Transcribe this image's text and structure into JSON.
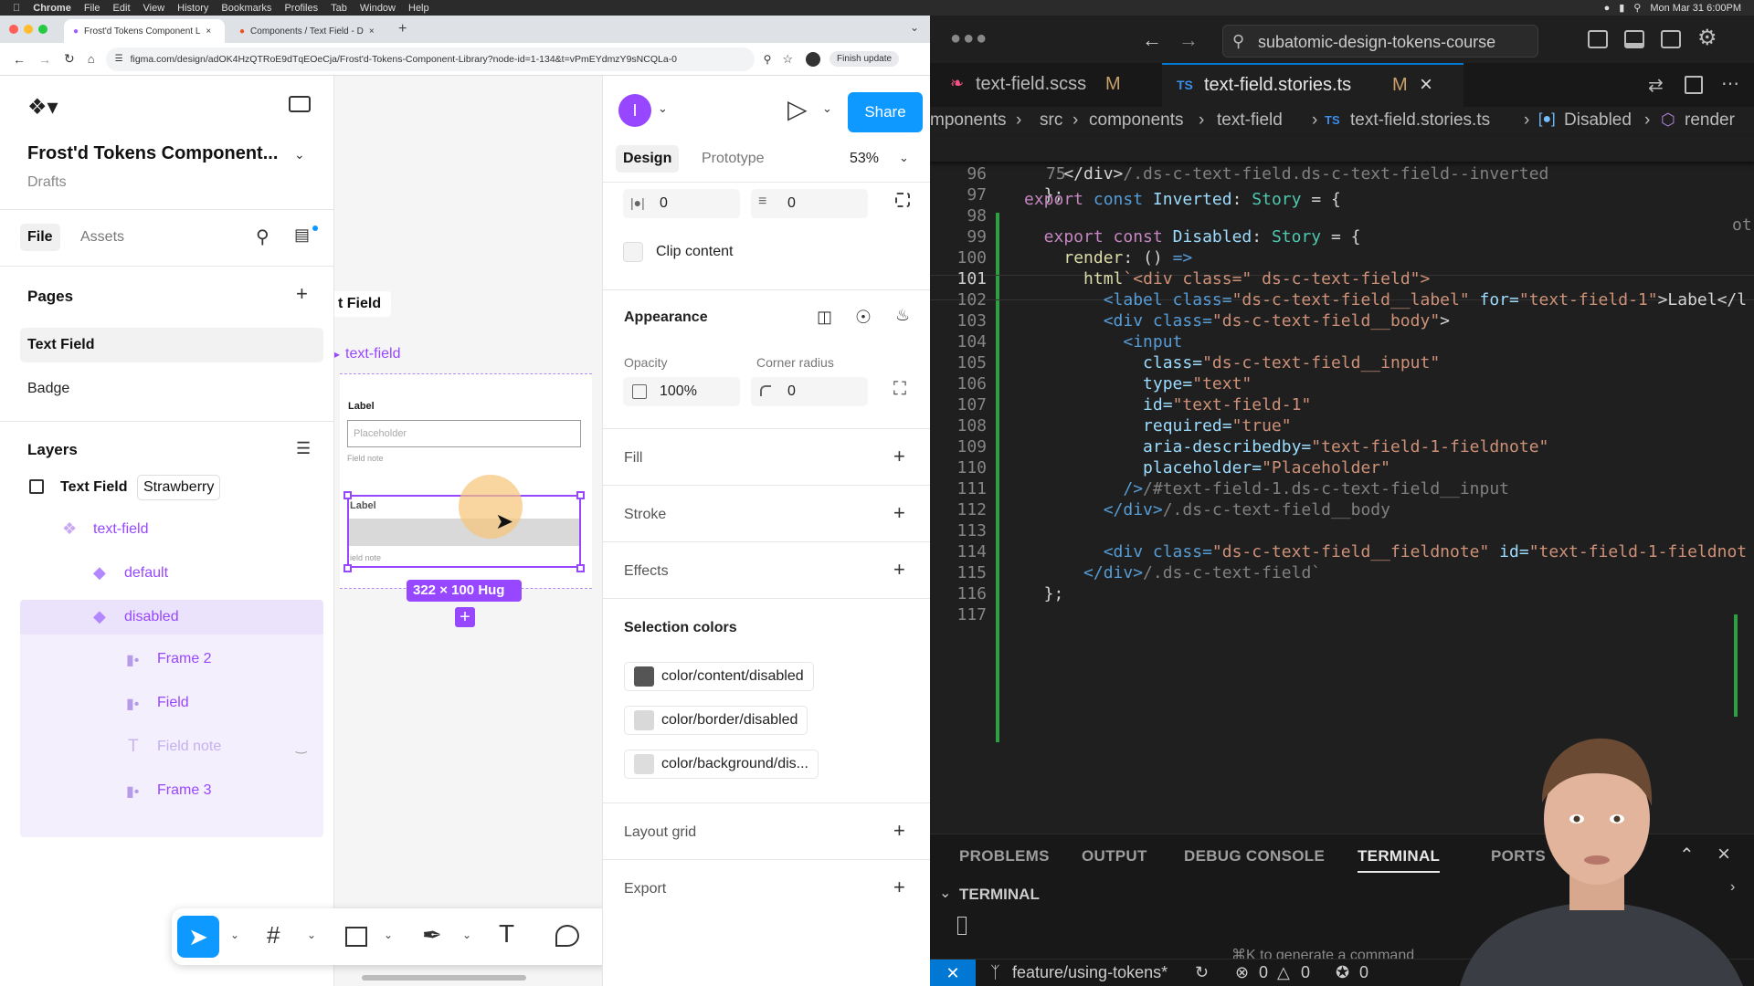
{
  "macos": {
    "app": "Chrome",
    "menus": [
      "File",
      "Edit",
      "View",
      "History",
      "Bookmarks",
      "Profiles",
      "Tab",
      "Window",
      "Help"
    ],
    "clock": "Mon Mar 31 6:00PM"
  },
  "browser": {
    "tabs": [
      {
        "title": "Frost'd Tokens Component L"
      },
      {
        "title": "Components / Text Field - D"
      }
    ],
    "url": "figma.com/design/adOK4HzQTRoE9dTqEOeCja/Frost'd-Tokens-Component-Library?node-id=1-134&t=vPmEYdmzY9sNCQLa-0",
    "finish_update": "Finish update"
  },
  "figma": {
    "file_title": "Frost'd Tokens Component...",
    "drafts": "Drafts",
    "tabs": {
      "file": "File",
      "assets": "Assets"
    },
    "pages_heading": "Pages",
    "pages": [
      {
        "label": "Text Field"
      },
      {
        "label": "Badge"
      }
    ],
    "layers_heading": "Layers",
    "layers": {
      "root": {
        "label": "Text Field",
        "badge": "Strawberry"
      },
      "component_set": "text-field",
      "default": "default",
      "disabled": "disabled",
      "frame2": "Frame 2",
      "field": "Field",
      "field_note": "Field note",
      "frame3": "Frame 3"
    },
    "canvas": {
      "frame_label": "t Field",
      "set_label": "text-field",
      "label1": "Label",
      "placeholder": "Placeholder",
      "note1": "Field note",
      "label2": "Label",
      "note2": "ield note",
      "size_badge": "322 × 100 Hug"
    },
    "right": {
      "avatar_letter": "I",
      "share": "Share",
      "design_tab": "Design",
      "prototype_tab": "Prototype",
      "zoom": "53%",
      "gap_h": "0",
      "gap_v": "0",
      "clip_content": "Clip content",
      "appearance": "Appearance",
      "opacity_label": "Opacity",
      "corner_label": "Corner radius",
      "opacity_value": "100%",
      "corner_value": "0",
      "fill": "Fill",
      "stroke": "Stroke",
      "effects": "Effects",
      "selection_colors": "Selection colors",
      "colors": [
        {
          "name": "color/content/disabled",
          "hex": "#555555"
        },
        {
          "name": "color/border/disabled",
          "hex": "#d9d9d9"
        },
        {
          "name": "color/background/dis...",
          "hex": "#dddddd"
        }
      ],
      "layout_grid": "Layout grid",
      "export": "Export"
    },
    "help": "?"
  },
  "vscode": {
    "search": "subatomic-design-tokens-course",
    "tabs": [
      {
        "label": "text-field.scss",
        "status": "M"
      },
      {
        "label": "text-field.stories.ts",
        "status": "M",
        "prefix": "TS"
      }
    ],
    "breadcrumb": {
      "p1": "mponents",
      "p2": "src",
      "p3": "components",
      "p4": "text-field",
      "file_prefix": "TS",
      "p5": "text-field.stories.ts",
      "p6": "Disabled",
      "p7": "render"
    },
    "sticky": {
      "ln": "75",
      "a": "export",
      "b": "const",
      "c": "Inverted",
      "d": ":",
      "e": "Story",
      "f": "= {",
      "right": "ot"
    },
    "lines": [
      {
        "ln": "96",
        "a": "    </div>",
        "b": "/.ds-c-text-field.ds-c-text-field--inverted",
        "c": "",
        "d": "",
        "e": ""
      },
      {
        "ln": "97",
        "a": "  };",
        "b": "",
        "c": "",
        "d": "",
        "e": ""
      },
      {
        "ln": "98",
        "a": "",
        "b": "",
        "c": "",
        "d": "",
        "e": ""
      },
      {
        "ln": "99",
        "a": "  export const ",
        "b": "Disabled",
        "c": ": ",
        "d": "Story",
        "e": " = {"
      },
      {
        "ln": "100",
        "a": "    ",
        "b": "render",
        "c": ": () ",
        "d": "=>",
        "e": ""
      },
      {
        "ln": "101",
        "a": "      ",
        "b": "html",
        "c": "`<div class=\" ds-c-text-field\">",
        "d": "",
        "e": ""
      },
      {
        "ln": "102",
        "a": "        <label class=",
        "b": "\"ds-c-text-field__label\"",
        "c": " for=",
        "d": "\"text-field-1\"",
        "e": ">Label</l"
      },
      {
        "ln": "103",
        "a": "        <div class=",
        "b": "\"ds-c-text-field__body\"",
        "c": ">",
        "d": "",
        "e": ""
      },
      {
        "ln": "104",
        "a": "          <input",
        "b": "",
        "c": "",
        "d": "",
        "e": ""
      },
      {
        "ln": "105",
        "a": "            class=",
        "b": "\"ds-c-text-field__input\"",
        "c": "",
        "d": "",
        "e": ""
      },
      {
        "ln": "106",
        "a": "            type=",
        "b": "\"text\"",
        "c": "",
        "d": "",
        "e": ""
      },
      {
        "ln": "107",
        "a": "            id=",
        "b": "\"text-field-1\"",
        "c": "",
        "d": "",
        "e": ""
      },
      {
        "ln": "108",
        "a": "            required=",
        "b": "\"true\"",
        "c": "",
        "d": "",
        "e": ""
      },
      {
        "ln": "109",
        "a": "            aria-describedby=",
        "b": "\"text-field-1-fieldnote\"",
        "c": "",
        "d": "",
        "e": ""
      },
      {
        "ln": "110",
        "a": "            placeholder=",
        "b": "\"Placeholder\"",
        "c": "",
        "d": "",
        "e": ""
      },
      {
        "ln": "111",
        "a": "          />",
        "b": "/#text-field-1.ds-c-text-field__input",
        "c": "",
        "d": "",
        "e": ""
      },
      {
        "ln": "112",
        "a": "        </div>",
        "b": "/.ds-c-text-field__body",
        "c": "",
        "d": "",
        "e": ""
      },
      {
        "ln": "113",
        "a": "",
        "b": "",
        "c": "",
        "d": "",
        "e": ""
      },
      {
        "ln": "114",
        "a": "        <div class=",
        "b": "\"ds-c-text-field__fieldnote\"",
        "c": " id=",
        "d": "\"text-field-1-fieldnot",
        "e": ""
      },
      {
        "ln": "115",
        "a": "      </div>",
        "b": "/.ds-c-text-field`",
        "c": "",
        "d": "",
        "e": ""
      },
      {
        "ln": "116",
        "a": "  };",
        "b": "",
        "c": "",
        "d": "",
        "e": ""
      },
      {
        "ln": "117",
        "a": "",
        "b": "",
        "c": "",
        "d": "",
        "e": ""
      }
    ],
    "panel_tabs": [
      "PROBLEMS",
      "OUTPUT",
      "DEBUG CONSOLE",
      "TERMINAL",
      "PORTS"
    ],
    "terminal_heading": "TERMINAL",
    "terminal_hint": "⌘K to generate a command",
    "status": {
      "branch": "feature/using-tokens*",
      "errors": "0",
      "warnings": "0",
      "ports": "0"
    }
  }
}
